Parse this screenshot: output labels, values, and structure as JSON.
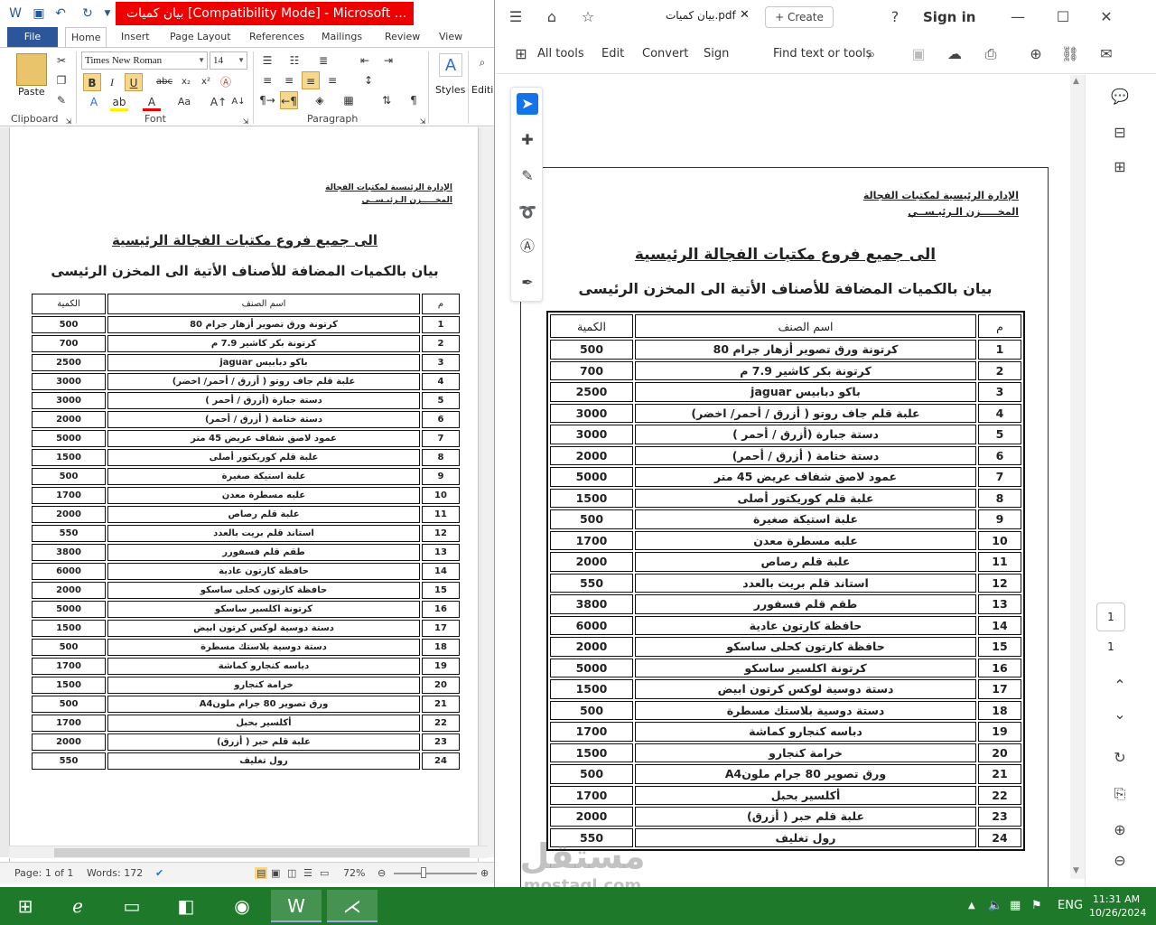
{
  "word": {
    "title": "بيان كميات [Compatibility Mode] - Microsoft ...",
    "tabs": [
      "File",
      "Home",
      "Insert",
      "Page Layout",
      "References",
      "Mailings",
      "Review",
      "View"
    ],
    "font_name": "Times New Roman",
    "font_size": "14",
    "groups": {
      "clipboard": "Clipboard",
      "font": "Font",
      "paragraph": "Paragraph",
      "styles": "Styles",
      "editing": "Editi"
    },
    "paste_label": "Paste",
    "status": {
      "page": "Page: 1 of 1",
      "words": "Words: 172",
      "zoom": "72%"
    }
  },
  "acrobat": {
    "tab_title": "بيان كميات.pdf",
    "create_label": "Create",
    "sign_in": "Sign in",
    "toolbar": [
      "All tools",
      "Edit",
      "Convert",
      "Sign"
    ],
    "find_label": "Find text or tools",
    "page_current": "1",
    "page_total": "1"
  },
  "document": {
    "header_line1": "الإدارة الرئيسية لمكتبات الفجالة",
    "header_line2": "المخـــــزن الـرئيـســي",
    "title": "الى جميع فروع مكتبات الفجالة الرئيسية",
    "subtitle": "بيان بالكميات المضافة للأصناف الأتية الى المخزن الرئيسى",
    "columns": [
      "م",
      "اسم الصنف",
      "الكمية"
    ],
    "rows": [
      [
        "1",
        "كرتونة  ورق تصوير أزهار جرام 80",
        "500"
      ],
      [
        "2",
        "كرتونة بكر كاشير 7.9 م",
        "700"
      ],
      [
        "3",
        "باكو دبابيس jaguar",
        "2500"
      ],
      [
        "4",
        "علبة قلم جاف روتو ( أزرق / أحمر/ اخضر)",
        "3000"
      ],
      [
        "5",
        "دستة جبارة  (أزرق / أحمر )",
        "3000"
      ],
      [
        "6",
        "دستة  ختامة   (  أزرق / أحمر)",
        "2000"
      ],
      [
        "7",
        "عمود لاصق شفاف عريض 45 متر",
        "5000"
      ],
      [
        "8",
        "علبة قلم كوريكتور أصلى",
        "1500"
      ],
      [
        "9",
        "علبة استيكة صغيرة",
        "500"
      ],
      [
        "10",
        "علبه مسطرة معدن",
        "1700"
      ],
      [
        "11",
        "علبة قلم رصاص",
        "2000"
      ],
      [
        "12",
        "استاند قلم بريت  بالعدد",
        "550"
      ],
      [
        "13",
        "طقم قلم فسفورر",
        "3800"
      ],
      [
        "14",
        "حافظة كارتون عادية",
        "6000"
      ],
      [
        "15",
        "حافظة كارتون كحلى ساسكو",
        "2000"
      ],
      [
        "16",
        "كرتونة  اكلسير ساسكو",
        "5000"
      ],
      [
        "17",
        "دستة دوسية لوكس كرتون  ابيض",
        "1500"
      ],
      [
        "18",
        "دستة  دوسية بلاستك مسطرة",
        "500"
      ],
      [
        "19",
        "دباسه كنجارو كماشة",
        "1700"
      ],
      [
        "20",
        "خرامة كنجارو",
        "1500"
      ],
      [
        "21",
        "ورق تصوير 80 جرام ملونA4",
        "500"
      ],
      [
        "22",
        "أكلسير بحبل",
        "1700"
      ],
      [
        "23",
        "علبة قلم حبر (  أزرق)",
        "2000"
      ],
      [
        "24",
        "رول تغليف",
        "550"
      ]
    ]
  },
  "watermark": {
    "line1": "مستقل",
    "line2": "mostaql.com"
  },
  "taskbar": {
    "lang": "ENG",
    "time": "11:31 AM",
    "date": "10/26/2024"
  }
}
